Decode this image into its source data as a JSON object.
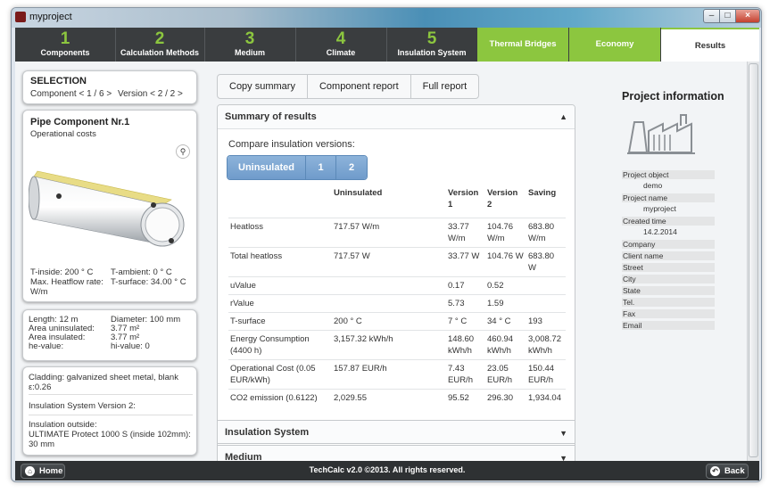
{
  "window": {
    "title": "myproject"
  },
  "nav": {
    "steps": [
      {
        "num": "1",
        "label": "Components"
      },
      {
        "num": "2",
        "label": "Calculation Methods"
      },
      {
        "num": "3",
        "label": "Medium"
      },
      {
        "num": "4",
        "label": "Climate"
      },
      {
        "num": "5",
        "label": "Insulation System"
      }
    ],
    "tabs": [
      "Thermal Bridges",
      "Economy",
      "Results"
    ],
    "colors": {
      "accent": "#8cc63f",
      "nav_bg": "#3a3d3f"
    }
  },
  "selection": {
    "title": "SELECTION",
    "component": "Component < 1 / 6 >",
    "version": "Version < 2 / 2 >"
  },
  "pipe": {
    "title": "Pipe Component Nr.1",
    "subtitle": "Operational costs",
    "zoom_icon": "magnifier-icon",
    "left_props": [
      "T-inside: 200 ° C",
      "Max. Heatflow rate: W/m"
    ],
    "right_props": [
      "T-ambient: 0 ° C",
      "T-surface: 34.00 ° C"
    ]
  },
  "dims": {
    "left": [
      "Length: 12 m",
      "Area uninsulated:",
      "Area insulated:",
      "he-value:"
    ],
    "right": [
      "Diameter: 100 mm",
      "3.77 m²",
      "3.77 m²",
      "hi-value: 0"
    ]
  },
  "cladding": {
    "cladding": "Cladding: galvanized sheet metal, blank ε:0.26",
    "version": "Insulation System Version 2:",
    "outside": "Insulation outside:",
    "product": "ULTIMATE Protect 1000 S (inside 102mm): 30 mm"
  },
  "buttons": {
    "copy": "Copy summary",
    "component": "Component report",
    "full": "Full report"
  },
  "summary": {
    "title": "Summary of results",
    "compare_label": "Compare insulation versions:",
    "segments": [
      "Uninsulated",
      "1",
      "2"
    ],
    "headers": [
      "",
      "Uninsulated",
      "Version 1",
      "Version 2",
      "Saving"
    ],
    "rows": [
      [
        "Heatloss",
        "717.57 W/m",
        "33.77 W/m",
        "104.76 W/m",
        "683.80 W/m"
      ],
      [
        "Total heatloss",
        "717.57 W",
        "33.77 W",
        "104.76 W",
        "683.80 W"
      ],
      [
        "uValue",
        "",
        "0.17",
        "0.52",
        ""
      ],
      [
        "rValue",
        "",
        "5.73",
        "1.59",
        ""
      ],
      [
        "T-surface",
        "200 ° C",
        "7 ° C",
        "34 ° C",
        "193"
      ],
      [
        "Energy Consumption (4400 h)",
        "3,157.32 kWh/h",
        "148.60 kWh/h",
        "460.94 kWh/h",
        "3,008.72 kWh/h"
      ],
      [
        "Operational Cost (0.05 EUR/kWh)",
        "157.87 EUR/h",
        "7.43 EUR/h",
        "23.05 EUR/h",
        "150.44 EUR/h"
      ],
      [
        "CO2 emission (0.6122)",
        "2,029.55",
        "95.52",
        "296.30",
        "1,934.04"
      ]
    ]
  },
  "accordions": [
    "Insulation System",
    "Medium"
  ],
  "project": {
    "title": "Project information",
    "fields": [
      {
        "label": "Project object",
        "value": "demo"
      },
      {
        "label": "Project name",
        "value": "myproject"
      },
      {
        "label": "Created time",
        "value": "14.2.2014"
      },
      {
        "label": "Company",
        "value": ""
      },
      {
        "label": "Client name",
        "value": ""
      },
      {
        "label": "Street",
        "value": ""
      },
      {
        "label": "City",
        "value": ""
      },
      {
        "label": "State",
        "value": ""
      },
      {
        "label": "Tel.",
        "value": ""
      },
      {
        "label": "Fax",
        "value": ""
      },
      {
        "label": "Email",
        "value": ""
      }
    ]
  },
  "footer": {
    "home": "Home",
    "copyright": "TechCalc v2.0 ©2013. All rights reserved.",
    "back": "Back"
  }
}
